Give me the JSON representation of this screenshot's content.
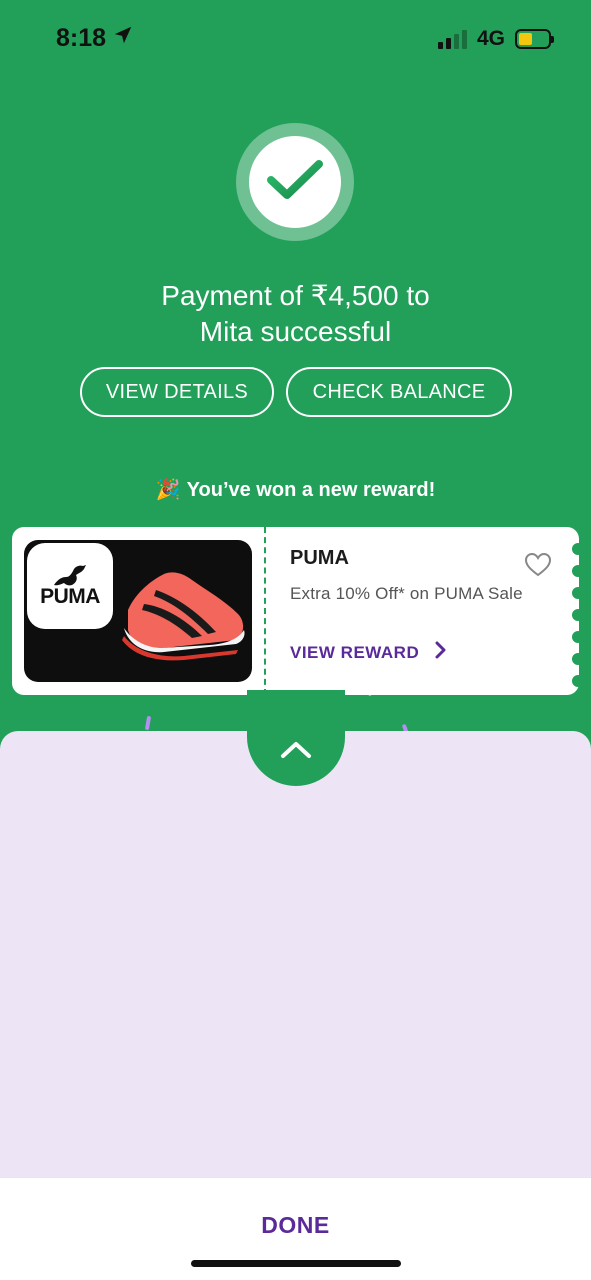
{
  "status_bar": {
    "time": "8:18",
    "network": "4G"
  },
  "payment": {
    "headline_line1": "Payment of ₹4,500 to",
    "headline_line2": "Mita successful"
  },
  "actions": {
    "view_details": "VIEW DETAILS",
    "check_balance": "CHECK BALANCE"
  },
  "reward": {
    "message": "You’ve won a new reward!",
    "brand": "PUMA",
    "logo_text": "PUMA",
    "offer": "Extra 10% Off* on PUMA Sale",
    "cta": "VIEW REWARD"
  },
  "footer": {
    "done": "DONE"
  },
  "colors": {
    "primary_green": "#22a05a",
    "accent_purple": "#5a2a9a",
    "panel_lavender": "#ede5f5"
  },
  "icons": [
    "location-arrow-icon",
    "signal-icon",
    "battery-icon",
    "checkmark-icon",
    "party-popper-icon",
    "heart-icon",
    "chevron-right-icon",
    "chevron-up-icon"
  ]
}
